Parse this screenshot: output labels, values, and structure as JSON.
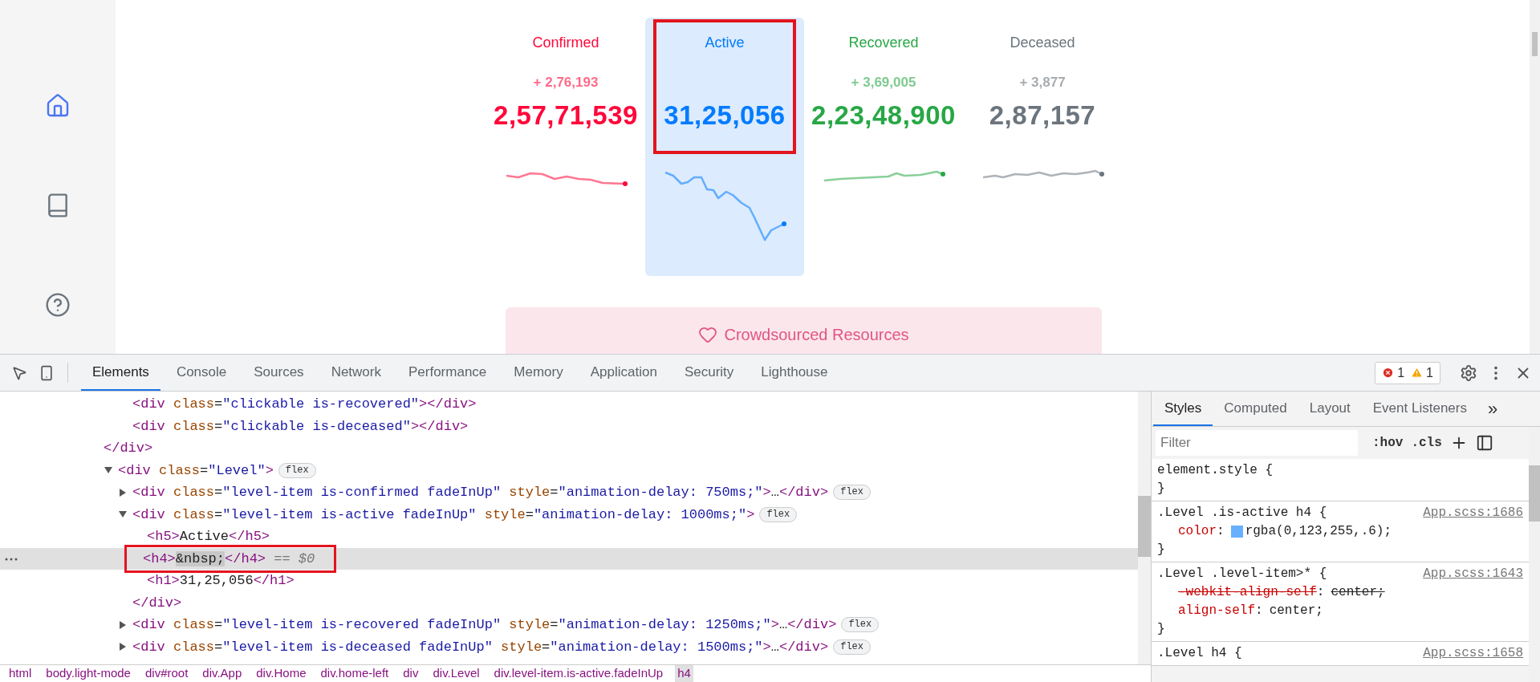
{
  "sidebar": {
    "items": [
      {
        "kind": "home",
        "selected": true
      },
      {
        "kind": "book",
        "selected": false
      },
      {
        "kind": "help",
        "selected": false
      }
    ]
  },
  "level": [
    {
      "label": "Confirmed",
      "delta": "+ 2,76,193",
      "total": "2,57,71,539",
      "color": "#ff073a",
      "selected": false,
      "outlined": false
    },
    {
      "label": "Active",
      "total": "31,25,056",
      "color": "#007bff",
      "selected": true,
      "outlined": true
    },
    {
      "label": "Recovered",
      "delta": "+ 3,69,005",
      "total": "2,23,48,900",
      "color": "#28a745",
      "selected": false,
      "outlined": false
    },
    {
      "label": "Deceased",
      "delta": "+ 3,877",
      "total": "2,87,157",
      "color": "#6c757d",
      "selected": false,
      "outlined": false
    }
  ],
  "banner": {
    "text": "Crowdsourced Resources"
  },
  "devtools": {
    "tabs": [
      {
        "label": "Elements",
        "selected": true
      },
      {
        "label": "Console",
        "selected": false
      },
      {
        "label": "Sources",
        "selected": false
      },
      {
        "label": "Network",
        "selected": false
      },
      {
        "label": "Performance",
        "selected": false
      },
      {
        "label": "Memory",
        "selected": false
      },
      {
        "label": "Application",
        "selected": false
      },
      {
        "label": "Security",
        "selected": false
      },
      {
        "label": "Lighthouse",
        "selected": false
      }
    ],
    "errors": "1",
    "warnings": "1"
  },
  "dom": [
    {
      "children": [
        {
          "selected": false,
          "outlined": false,
          "line": [
            {
              "kind": "tag",
              "text": "<div"
            },
            {
              "kind": "attr",
              "text": " class"
            },
            {
              "kind": "punct",
              "text": "="
            },
            {
              "kind": "value",
              "text": "\"clickable is-recovered\""
            },
            {
              "kind": "tag",
              "text": "></div>"
            }
          ]
        },
        {
          "selected": false,
          "outlined": false,
          "line": [
            {
              "kind": "tag",
              "text": "<div"
            },
            {
              "kind": "attr",
              "text": " class"
            },
            {
              "kind": "punct",
              "text": "="
            },
            {
              "kind": "value",
              "text": "\"clickable is-deceased\""
            },
            {
              "kind": "tag",
              "text": "></div>"
            }
          ]
        }
      ],
      "close": [
        {
          "kind": "tag",
          "text": "</div>"
        }
      ]
    },
    {
      "selected": false,
      "outlined": false,
      "expanded": true,
      "badge": "flex",
      "line": [
        {
          "kind": "tag",
          "text": "<div"
        },
        {
          "kind": "attr",
          "text": " class"
        },
        {
          "kind": "punct",
          "text": "="
        },
        {
          "kind": "value",
          "text": "\"Level\""
        },
        {
          "kind": "tag",
          "text": ">"
        }
      ],
      "children": [
        {
          "selected": false,
          "outlined": false,
          "expanded": false,
          "badge": "flex",
          "line": [
            {
              "kind": "tag",
              "text": "<div"
            },
            {
              "kind": "attr",
              "text": " class"
            },
            {
              "kind": "punct",
              "text": "="
            },
            {
              "kind": "value",
              "text": "\"level-item is-confirmed fadeInUp\""
            },
            {
              "kind": "attr",
              "text": " style"
            },
            {
              "kind": "punct",
              "text": "="
            },
            {
              "kind": "value",
              "text": "\"animation-delay: 750ms;\""
            },
            {
              "kind": "tag",
              "text": ">"
            },
            {
              "kind": "text",
              "text": "…"
            },
            {
              "kind": "tag",
              "text": "</div>"
            }
          ]
        },
        {
          "selected": false,
          "outlined": false,
          "expanded": true,
          "badge": "flex",
          "line": [
            {
              "kind": "tag",
              "text": "<div"
            },
            {
              "kind": "attr",
              "text": " class"
            },
            {
              "kind": "punct",
              "text": "="
            },
            {
              "kind": "value",
              "text": "\"level-item is-active fadeInUp\""
            },
            {
              "kind": "attr",
              "text": " style"
            },
            {
              "kind": "punct",
              "text": "="
            },
            {
              "kind": "value",
              "text": "\"animation-delay: 1000ms;\""
            },
            {
              "kind": "tag",
              "text": ">"
            }
          ],
          "children": [
            {
              "selected": false,
              "outlined": false,
              "line": [
                {
                  "kind": "tag",
                  "text": "<h5>"
                },
                {
                  "kind": "text",
                  "text": "Active"
                },
                {
                  "kind": "tag",
                  "text": "</h5>"
                }
              ]
            },
            {
              "selected": true,
              "outlined": true,
              "line": [
                {
                  "kind": "tag",
                  "text": "<h4>"
                },
                {
                  "kind": "entity",
                  "text": "&nbsp;"
                },
                {
                  "kind": "tag",
                  "text": "</h4>"
                },
                {
                  "kind": "ref",
                  "text": " == $0"
                }
              ]
            },
            {
              "selected": false,
              "outlined": false,
              "line": [
                {
                  "kind": "tag",
                  "text": "<h1>"
                },
                {
                  "kind": "text",
                  "text": "31,25,056"
                },
                {
                  "kind": "tag",
                  "text": "</h1>"
                }
              ]
            }
          ],
          "close": [
            {
              "kind": "tag",
              "text": "</div>"
            }
          ]
        },
        {
          "selected": false,
          "outlined": false,
          "expanded": false,
          "badge": "flex",
          "line": [
            {
              "kind": "tag",
              "text": "<div"
            },
            {
              "kind": "attr",
              "text": " class"
            },
            {
              "kind": "punct",
              "text": "="
            },
            {
              "kind": "value",
              "text": "\"level-item is-recovered fadeInUp\""
            },
            {
              "kind": "attr",
              "text": " style"
            },
            {
              "kind": "punct",
              "text": "="
            },
            {
              "kind": "value",
              "text": "\"animation-delay: 1250ms;\""
            },
            {
              "kind": "tag",
              "text": ">"
            },
            {
              "kind": "text",
              "text": "…"
            },
            {
              "kind": "tag",
              "text": "</div>"
            }
          ]
        },
        {
          "selected": false,
          "outlined": false,
          "expanded": false,
          "badge": "flex",
          "line": [
            {
              "kind": "tag",
              "text": "<div"
            },
            {
              "kind": "attr",
              "text": " class"
            },
            {
              "kind": "punct",
              "text": "="
            },
            {
              "kind": "value",
              "text": "\"level-item is-deceased fadeInUp\""
            },
            {
              "kind": "attr",
              "text": " style"
            },
            {
              "kind": "punct",
              "text": "="
            },
            {
              "kind": "value",
              "text": "\"animation-delay: 1500ms;\""
            },
            {
              "kind": "tag",
              "text": ">"
            },
            {
              "kind": "text",
              "text": "…"
            },
            {
              "kind": "tag",
              "text": "</div>"
            }
          ]
        }
      ]
    }
  ],
  "breadcrumb": [
    {
      "label": "html",
      "selected": false
    },
    {
      "label": "body.light-mode",
      "selected": false
    },
    {
      "label": "div#root",
      "selected": false
    },
    {
      "label": "div.App",
      "selected": false
    },
    {
      "label": "div.Home",
      "selected": false
    },
    {
      "label": "div.home-left",
      "selected": false
    },
    {
      "label": "div",
      "selected": false
    },
    {
      "label": "div.Level",
      "selected": false
    },
    {
      "label": "div.level-item.is-active.fadeInUp",
      "selected": false
    },
    {
      "label": "h4",
      "selected": true
    }
  ],
  "styles": {
    "tabs": [
      {
        "label": "Styles",
        "selected": true
      },
      {
        "label": "Computed",
        "selected": false
      },
      {
        "label": "Layout",
        "selected": false
      },
      {
        "label": "Event Listeners",
        "selected": false
      }
    ],
    "more": "»",
    "filter_placeholder": "Filter",
    "hov": ":hov",
    "cls": ".cls",
    "rules": [
      {
        "selector": "element.style {",
        "close": "}"
      },
      {
        "selector": ".Level .is-active h4 {",
        "source": "App.scss:1686",
        "close": "}",
        "props": [
          {
            "name": "color",
            "colon": ":",
            "value": "rgba(0,123,255,.6);",
            "color": "#66b0ff",
            "overridden": false
          }
        ]
      },
      {
        "selector": ".Level .level-item>* {",
        "source": "App.scss:1643",
        "close": "}",
        "props": [
          {
            "name": "-webkit-align-self",
            "colon": ":",
            "value": "center;",
            "overridden": true
          },
          {
            "name": "align-self",
            "colon": ":",
            "value": "center;",
            "overridden": false
          }
        ]
      },
      {
        "selector": ".Level h4 {",
        "source": "App.scss:1658"
      }
    ]
  }
}
